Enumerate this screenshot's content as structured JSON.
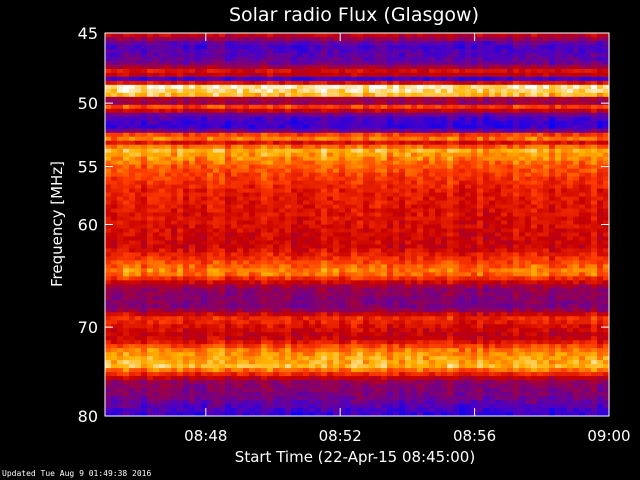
{
  "chart_data": {
    "type": "heatmap",
    "title": "Solar radio Flux (Glasgow)",
    "xlabel": "Start Time (22-Apr-15 08:45:00)",
    "ylabel": "Frequency [MHz]",
    "x_range": [
      "08:45:00",
      "09:00:00"
    ],
    "x_ticks": [
      "08:48",
      "08:52",
      "08:56",
      "09:00"
    ],
    "x_tick_values_minutes": [
      3,
      7,
      11,
      15
    ],
    "y_range": [
      45,
      80
    ],
    "y_scale": "log",
    "y_inverted": true,
    "y_ticks": [
      "45",
      "50",
      "55",
      "60",
      "70",
      "80"
    ],
    "y_tick_values": [
      45,
      50,
      55,
      60,
      70,
      80
    ],
    "colormap": [
      "#0000ff",
      "#5000c0",
      "#8c0060",
      "#c80000",
      "#ff3c00",
      "#ffb400",
      "#ffffff"
    ],
    "frequency_profile": [
      {
        "f": 45.0,
        "level": 0.55
      },
      {
        "f": 45.8,
        "level": 0.15
      },
      {
        "f": 47.0,
        "level": 0.22
      },
      {
        "f": 47.8,
        "level": 0.62
      },
      {
        "f": 48.2,
        "level": 0.12
      },
      {
        "f": 48.8,
        "level": 0.96
      },
      {
        "f": 49.4,
        "level": 0.85
      },
      {
        "f": 49.8,
        "level": 0.2
      },
      {
        "f": 50.3,
        "level": 0.68
      },
      {
        "f": 51.0,
        "level": 0.16
      },
      {
        "f": 52.0,
        "level": 0.1
      },
      {
        "f": 52.6,
        "level": 0.88
      },
      {
        "f": 53.0,
        "level": 0.5
      },
      {
        "f": 53.6,
        "level": 0.84
      },
      {
        "f": 55.0,
        "level": 0.7
      },
      {
        "f": 57.0,
        "level": 0.58
      },
      {
        "f": 60.0,
        "level": 0.54
      },
      {
        "f": 62.0,
        "level": 0.5
      },
      {
        "f": 64.5,
        "level": 0.78
      },
      {
        "f": 66.0,
        "level": 0.35
      },
      {
        "f": 68.0,
        "level": 0.28
      },
      {
        "f": 69.0,
        "level": 0.62
      },
      {
        "f": 71.0,
        "level": 0.46
      },
      {
        "f": 72.6,
        "level": 0.78
      },
      {
        "f": 74.3,
        "level": 0.85
      },
      {
        "f": 76.0,
        "level": 0.34
      },
      {
        "f": 78.0,
        "level": 0.26
      },
      {
        "f": 79.5,
        "level": 0.12
      },
      {
        "f": 80.0,
        "level": 0.1
      }
    ]
  },
  "footer": "Updated Tue Aug  9 01:49:38 2016",
  "colors": {
    "background": "#000000",
    "text": "#ffffff"
  }
}
